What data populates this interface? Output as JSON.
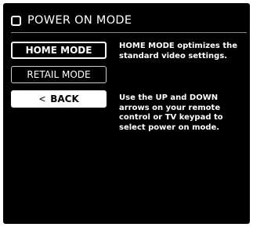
{
  "header": {
    "title": "POWER ON MODE",
    "icon": "checkbox-square-icon"
  },
  "menu": {
    "items": [
      {
        "label": "HOME MODE",
        "state": "focused"
      },
      {
        "label": "RETAIL MODE",
        "state": "normal"
      }
    ],
    "back": {
      "label": "BACK",
      "icon": "chevron-left-icon"
    }
  },
  "info": {
    "description": "HOME MODE optimizes the standard video settings.",
    "instructions": "Use the UP and DOWN arrows on your remote control or TV keypad to select power on mode."
  },
  "colors": {
    "background": "#000000",
    "text": "#ffffff",
    "button_focused_border": "#ffffff",
    "back_button_fill": "#ffffff"
  }
}
